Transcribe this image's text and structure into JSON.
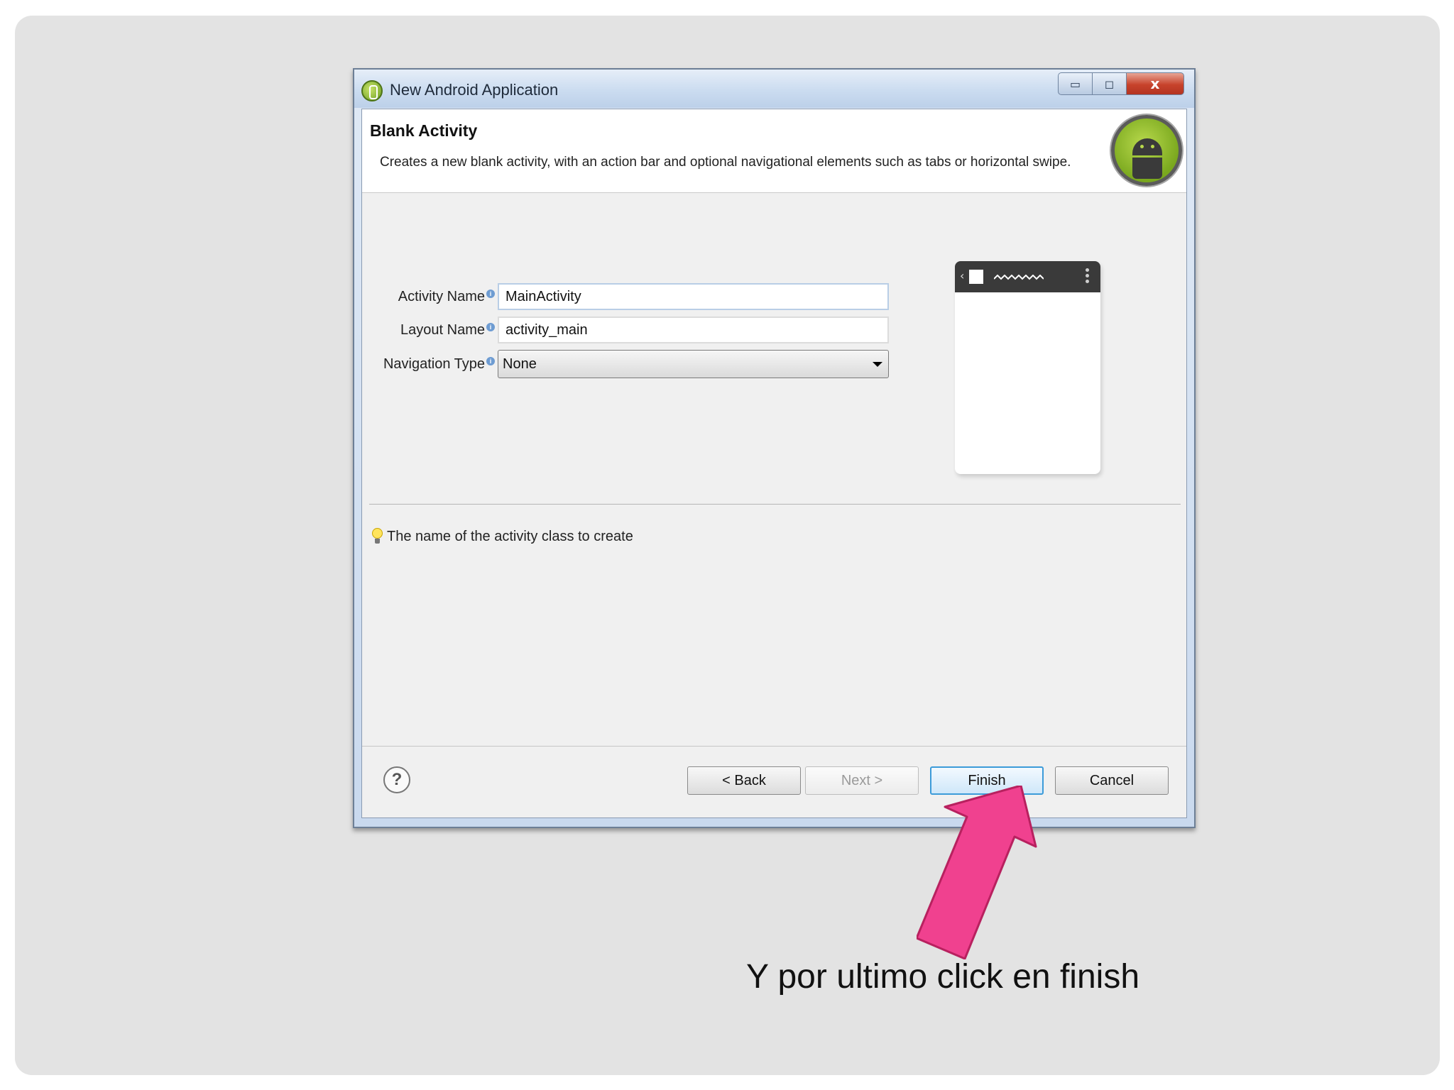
{
  "window": {
    "title": "New Android Application",
    "minimize_glyph": "▭",
    "maximize_glyph": "◻",
    "close_glyph": "x"
  },
  "header": {
    "title": "Blank Activity",
    "description": "Creates a new blank activity, with an action bar and optional navigational elements such as tabs or horizontal swipe."
  },
  "form": {
    "activity_name": {
      "label": "Activity Name",
      "value": "MainActivity"
    },
    "layout_name": {
      "label": "Layout Name",
      "value": "activity_main"
    },
    "navigation_type": {
      "label": "Navigation Type",
      "selected": "None"
    }
  },
  "hint": "The name of the activity class to create",
  "buttons": {
    "help": "?",
    "back": "< Back",
    "next": "Next >",
    "finish": "Finish",
    "cancel": "Cancel"
  },
  "annotation": {
    "caption": "Y por ultimo click en finish",
    "arrow_color": "#f0418f"
  },
  "colors": {
    "slide_background": "#e3e3e3",
    "finish_focus": "#3c9bd9"
  }
}
